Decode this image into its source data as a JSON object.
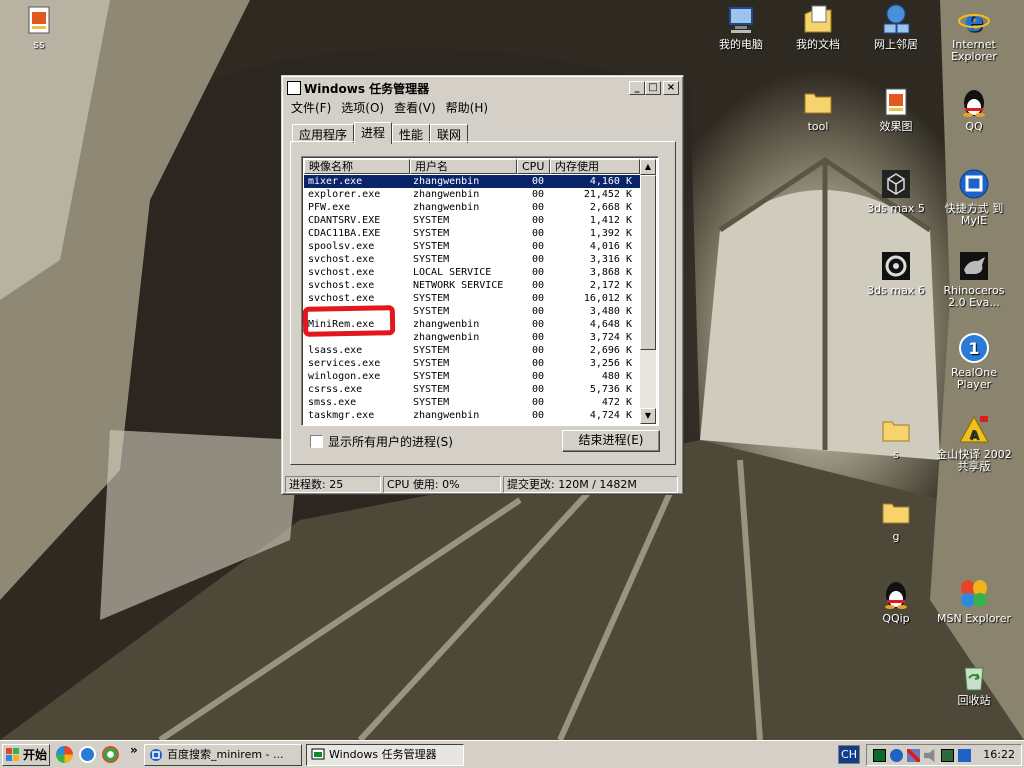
{
  "desktop": {
    "icons": [
      {
        "label": "ss",
        "icon": "image-file-icon"
      },
      {
        "label": "我的电脑",
        "icon": "my-computer-icon"
      },
      {
        "label": "我的文档",
        "icon": "my-documents-icon"
      },
      {
        "label": "网上邻居",
        "icon": "network-places-icon"
      },
      {
        "label": "Internet Explorer",
        "icon": "internet-explorer-icon"
      },
      {
        "label": "tool",
        "icon": "folder-icon"
      },
      {
        "label": "效果图",
        "icon": "image-file-icon"
      },
      {
        "label": "QQ",
        "icon": "qq-penguin-icon"
      },
      {
        "label": "3ds max 5",
        "icon": "3dsmax-icon"
      },
      {
        "label": "快捷方式 到 MyIE",
        "icon": "myie-icon"
      },
      {
        "label": "3ds max 6",
        "icon": "3dsmax6-icon"
      },
      {
        "label": "Rhinoceros 2.0 Eva...",
        "icon": "rhinoceros-icon"
      },
      {
        "label": "RealOne Player",
        "icon": "realone-player-icon"
      },
      {
        "label": "s",
        "icon": "folder-icon"
      },
      {
        "label": "金山快译 2002 共享版",
        "icon": "kingsoft-translator-icon"
      },
      {
        "label": "g",
        "icon": "folder-icon"
      },
      {
        "label": "QQip",
        "icon": "qq-penguin-icon"
      },
      {
        "label": "MSN Explorer",
        "icon": "msn-butterfly-icon"
      },
      {
        "label": "回收站",
        "icon": "recycle-bin-icon"
      }
    ]
  },
  "task_manager": {
    "title": "Windows 任务管理器",
    "controls": {
      "minimize": "_",
      "maximize": "□",
      "close": "×"
    },
    "menu": [
      "文件(F)",
      "选项(O)",
      "查看(V)",
      "帮助(H)"
    ],
    "tabs": [
      "应用程序",
      "进程",
      "性能",
      "联网"
    ],
    "active_tab": "进程",
    "columns": [
      "映像名称",
      "用户名",
      "CPU",
      "内存使用"
    ],
    "processes": [
      {
        "name": "mixer.exe",
        "user": "zhangwenbin",
        "cpu": "00",
        "mem": "4,160 K",
        "selected": true
      },
      {
        "name": "explorer.exe",
        "user": "zhangwenbin",
        "cpu": "00",
        "mem": "21,452 K"
      },
      {
        "name": "PFW.exe",
        "user": "zhangwenbin",
        "cpu": "00",
        "mem": "2,668 K"
      },
      {
        "name": "CDANTSRV.EXE",
        "user": "SYSTEM",
        "cpu": "00",
        "mem": "1,412 K"
      },
      {
        "name": "CDAC11BA.EXE",
        "user": "SYSTEM",
        "cpu": "00",
        "mem": "1,392 K"
      },
      {
        "name": "spoolsv.exe",
        "user": "SYSTEM",
        "cpu": "00",
        "mem": "4,016 K"
      },
      {
        "name": "svchost.exe",
        "user": "SYSTEM",
        "cpu": "00",
        "mem": "3,316 K"
      },
      {
        "name": "svchost.exe",
        "user": "LOCAL SERVICE",
        "cpu": "00",
        "mem": "3,868 K"
      },
      {
        "name": "svchost.exe",
        "user": "NETWORK SERVICE",
        "cpu": "00",
        "mem": "2,172 K"
      },
      {
        "name": "svchost.exe",
        "user": "SYSTEM",
        "cpu": "00",
        "mem": "16,012 K"
      },
      {
        "name": "",
        "user": "SYSTEM",
        "cpu": "00",
        "mem": "3,480 K"
      },
      {
        "name": "MiniRem.exe",
        "user": "zhangwenbin",
        "cpu": "00",
        "mem": "4,648 K"
      },
      {
        "name": "",
        "user": "zhangwenbin",
        "cpu": "00",
        "mem": "3,724 K"
      },
      {
        "name": "lsass.exe",
        "user": "SYSTEM",
        "cpu": "00",
        "mem": "2,696 K"
      },
      {
        "name": "services.exe",
        "user": "SYSTEM",
        "cpu": "00",
        "mem": "3,256 K"
      },
      {
        "name": "winlogon.exe",
        "user": "SYSTEM",
        "cpu": "00",
        "mem": "480 K"
      },
      {
        "name": "csrss.exe",
        "user": "SYSTEM",
        "cpu": "00",
        "mem": "5,736 K"
      },
      {
        "name": "smss.exe",
        "user": "SYSTEM",
        "cpu": "00",
        "mem": "472 K"
      },
      {
        "name": "taskmgr.exe",
        "user": "zhangwenbin",
        "cpu": "00",
        "mem": "4,724 K"
      }
    ],
    "show_all_users": "显示所有用户的进程(S)",
    "end_process": "结束进程(E)",
    "status": {
      "processes": "进程数: 25",
      "cpu": "CPU 使用: 0%",
      "commit": "提交更改: 120M / 1482M"
    }
  },
  "taskbar": {
    "start": "开始",
    "quicklaunch_more": "»",
    "buttons": [
      {
        "label": "百度搜索_minirem - ...",
        "icon": "myie-icon",
        "active": false
      },
      {
        "label": "Windows 任务管理器",
        "icon": "task-manager-icon",
        "active": true
      }
    ],
    "language": "CH",
    "clock": "16:22"
  },
  "colors": {
    "highlight": "#0a246a",
    "annotation_red": "#e2171b",
    "window_face": "#d4d0c8"
  }
}
